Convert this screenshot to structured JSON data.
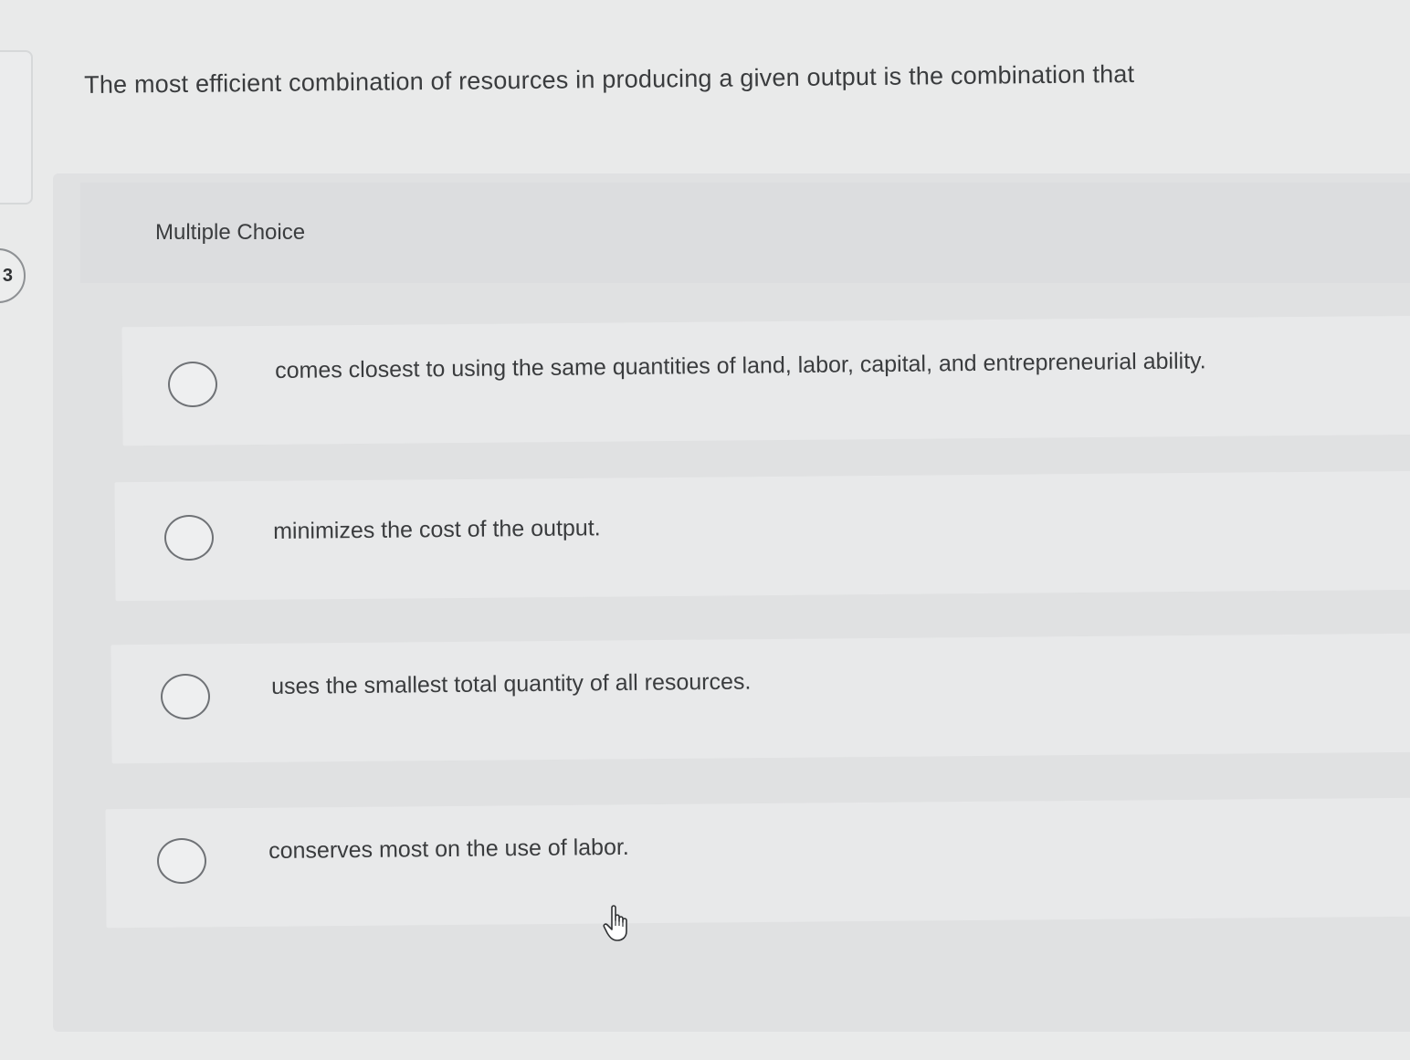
{
  "question": {
    "number": "3",
    "prompt": "The most efficient combination of resources in producing a given output is the combination that"
  },
  "multiple_choice": {
    "label": "Multiple Choice",
    "options": [
      {
        "text": "comes closest to using the same quantities of land, labor, capital, and entrepreneurial ability.",
        "selected": false
      },
      {
        "text": "minimizes the cost of the output.",
        "selected": false
      },
      {
        "text": "uses the smallest total quantity of all resources.",
        "selected": false
      },
      {
        "text": "conserves most on the use of labor.",
        "selected": false
      }
    ]
  },
  "cursor": {
    "icon": "hand-pointer-icon"
  }
}
